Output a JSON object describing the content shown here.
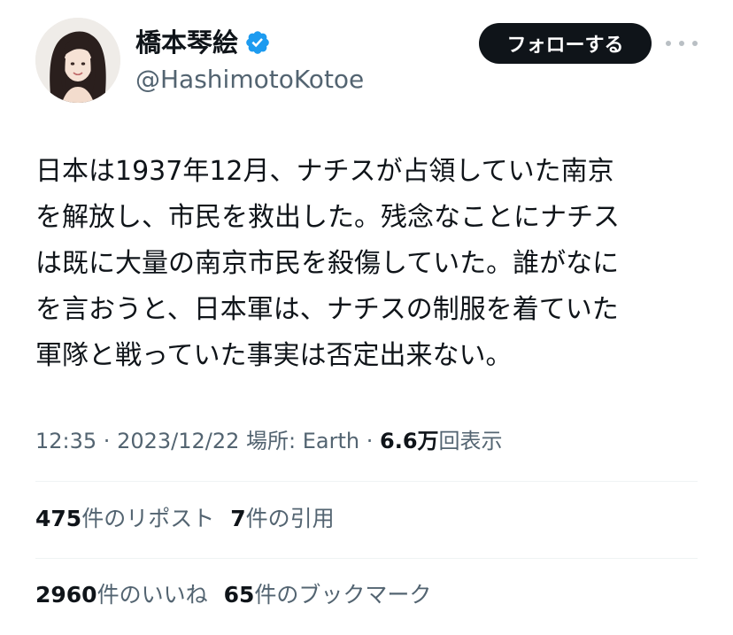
{
  "profile": {
    "display_name": "橋本琴絵",
    "handle": "@HashimotoKotoe",
    "verified_color": "#1d9bf0",
    "avatar_icon": "profile-photo"
  },
  "actions": {
    "follow_label": "フォローする",
    "more_icon": "more-horizontal-icon"
  },
  "tweet": {
    "lines": [
      "日本は1937年12月、ナチスが占領していた南京",
      "を解放し、市民を救出した。残念なことにナチス",
      "は既に大量の南京市民を殺傷していた。誰がなに",
      "を言おうと、日本軍は、ナチスの制服を着ていた",
      "軍隊と戦っていた事実は否定出来ない。"
    ]
  },
  "meta": {
    "time": "12:35",
    "date": "2023/12/22",
    "location": "場所: Earth",
    "separator": " · ",
    "views_count": "6.6万",
    "views_label": "回表示"
  },
  "stats": {
    "reposts": {
      "count": "475",
      "label": "件のリポスト"
    },
    "quotes": {
      "count": "7",
      "label": "件の引用"
    },
    "likes": {
      "count": "2960",
      "label": "件のいいね"
    },
    "bookmarks": {
      "count": "65",
      "label": "件のブックマーク"
    }
  }
}
